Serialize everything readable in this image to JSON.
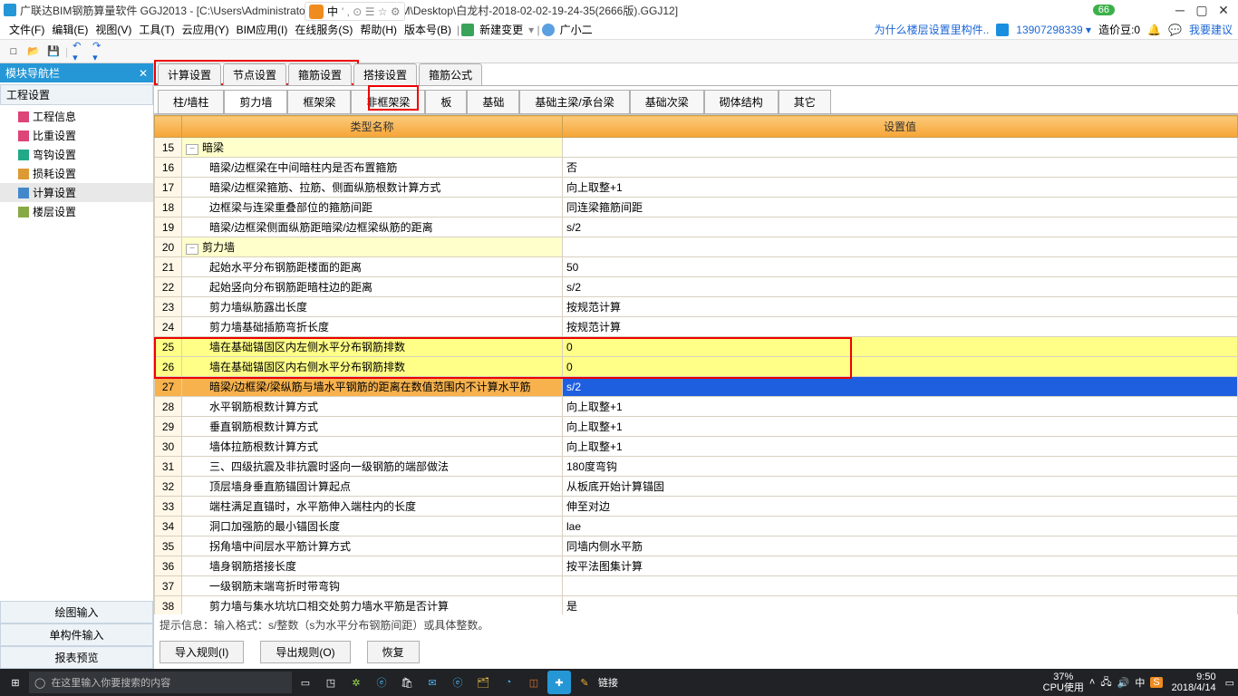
{
  "title": "广联达BIM钢筋算量软件 GGJ2013 - [C:\\Users\\Administrator.PC-20141127NRHM\\Desktop\\白龙村-2018-02-02-19-24-35(2666版).GGJ12]",
  "ime": {
    "text": "中",
    "extra": "' , ⊙ ☰ ☆ ⚙"
  },
  "titlebar_badge": "66",
  "menu": [
    "文件(F)",
    "编辑(E)",
    "视图(V)",
    "工具(T)",
    "云应用(Y)",
    "BIM应用(I)",
    "在线服务(S)",
    "帮助(H)",
    "版本号(B)"
  ],
  "menu_extra": {
    "new_change": "新建变更",
    "user_small": "广小二"
  },
  "right_menu": {
    "q": "为什么楼层设置里构件..",
    "phone": "13907298339",
    "bean_label": "造价豆:0",
    "suggest": "我要建议"
  },
  "nav": {
    "title": "模块导航栏",
    "section": "工程设置",
    "items": [
      "工程信息",
      "比重设置",
      "弯钩设置",
      "损耗设置",
      "计算设置",
      "楼层设置"
    ],
    "selected": 4,
    "buttons": [
      "绘图输入",
      "单构件输入",
      "报表预览"
    ]
  },
  "tabs1": [
    "计算设置",
    "节点设置",
    "箍筋设置",
    "搭接设置",
    "箍筋公式"
  ],
  "tabs2": [
    "柱/墙柱",
    "剪力墙",
    "框架梁",
    "非框架梁",
    "板",
    "基础",
    "基础主梁/承台梁",
    "基础次梁",
    "砌体结构",
    "其它"
  ],
  "tabs2_active": 1,
  "grid": {
    "head": [
      "",
      "类型名称",
      "设置值"
    ],
    "rows": [
      {
        "n": 15,
        "grp": true,
        "name": "暗梁",
        "val": ""
      },
      {
        "n": 16,
        "name": "暗梁/边框梁在中间暗柱内是否布置箍筋",
        "val": "否"
      },
      {
        "n": 17,
        "name": "暗梁/边框梁箍筋、拉筋、侧面纵筋根数计算方式",
        "val": "向上取整+1"
      },
      {
        "n": 18,
        "name": "边框梁与连梁重叠部位的箍筋间距",
        "val": "同连梁箍筋间距"
      },
      {
        "n": 19,
        "name": "暗梁/边框梁侧面纵筋距暗梁/边框梁纵筋的距离",
        "val": "s/2"
      },
      {
        "n": 20,
        "grp": true,
        "name": "剪力墙",
        "val": ""
      },
      {
        "n": 21,
        "name": "起始水平分布钢筋距楼面的距离",
        "val": "50"
      },
      {
        "n": 22,
        "name": "起始竖向分布钢筋距暗柱边的距离",
        "val": "s/2"
      },
      {
        "n": 23,
        "name": "剪力墙纵筋露出长度",
        "val": "按规范计算"
      },
      {
        "n": 24,
        "name": "剪力墙基础插筋弯折长度",
        "val": "按规范计算"
      },
      {
        "n": 25,
        "hl": "y",
        "name": "墙在基础锚固区内左侧水平分布钢筋排数",
        "val": "0"
      },
      {
        "n": 26,
        "hl": "y",
        "name": "墙在基础锚固区内右侧水平分布钢筋排数",
        "val": "0"
      },
      {
        "n": 27,
        "hl": "o",
        "name": "暗梁/边框梁/梁纵筋与墙水平钢筋的距离在数值范围内不计算水平筋",
        "val": "s/2"
      },
      {
        "n": 28,
        "name": "水平钢筋根数计算方式",
        "val": "向上取整+1"
      },
      {
        "n": 29,
        "name": "垂直钢筋根数计算方式",
        "val": "向上取整+1"
      },
      {
        "n": 30,
        "name": "墙体拉筋根数计算方式",
        "val": "向上取整+1"
      },
      {
        "n": 31,
        "name": "三、四级抗震及非抗震时竖向一级钢筋的端部做法",
        "val": "180度弯钩"
      },
      {
        "n": 32,
        "name": "顶层墙身垂直筋锚固计算起点",
        "val": "从板底开始计算锚固"
      },
      {
        "n": 33,
        "name": "端柱满足直锚时，水平筋伸入端柱内的长度",
        "val": "伸至对边"
      },
      {
        "n": 34,
        "name": "洞口加强筋的最小锚固长度",
        "val": "lae"
      },
      {
        "n": 35,
        "name": "拐角墙中间层水平筋计算方式",
        "val": "同墙内侧水平筋"
      },
      {
        "n": 36,
        "name": "墙身钢筋搭接长度",
        "val": "按平法图集计算"
      },
      {
        "n": 37,
        "name": "一级钢筋末端弯折时带弯钩",
        "val": ""
      },
      {
        "n": 38,
        "name": "剪力墙与集水坑坑口相交处剪力墙水平筋是否计算",
        "val": "是"
      }
    ]
  },
  "hint": "提示信息：输入格式：s/整数（s为水平分布钢筋间距）或具体整数。",
  "export": {
    "in": "导入规则(I)",
    "out": "导出规则(O)",
    "restore": "恢复"
  },
  "taskbar": {
    "search": "在这里输入你要搜索的内容",
    "label_link": "链接",
    "cpu": "37%",
    "cpu_label": "CPU使用",
    "clock": "9:50",
    "date": "2018/4/14"
  }
}
